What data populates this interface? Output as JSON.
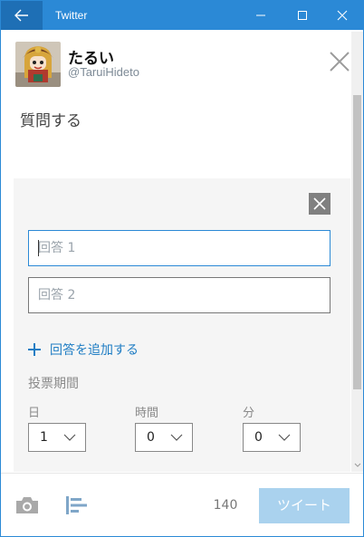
{
  "window": {
    "title": "Twitter"
  },
  "user": {
    "display_name": "たるい",
    "handle": "@TaruiHideto"
  },
  "compose": {
    "text": "質問する"
  },
  "poll": {
    "choices": [
      {
        "placeholder": "回答 1",
        "value": ""
      },
      {
        "placeholder": "回答 2",
        "value": ""
      }
    ],
    "add_choice_label": "回答を追加する",
    "length_label": "投票期間",
    "day_label": "日",
    "hour_label": "時間",
    "minute_label": "分",
    "day_value": "1",
    "hour_value": "0",
    "minute_value": "0"
  },
  "toolbar": {
    "char_count": "140",
    "tweet_label": "ツイート"
  },
  "colors": {
    "accent": "#2b89d6",
    "link": "#1f7dc4",
    "tweet_disabled": "#aad2ee",
    "panel_bg": "#f5f5f5"
  },
  "icons": {
    "back": "arrow-left-icon",
    "minimize": "minimize-icon",
    "maximize": "maximize-icon",
    "close": "close-icon",
    "photo": "camera-icon",
    "poll": "poll-icon",
    "add": "plus-icon"
  }
}
